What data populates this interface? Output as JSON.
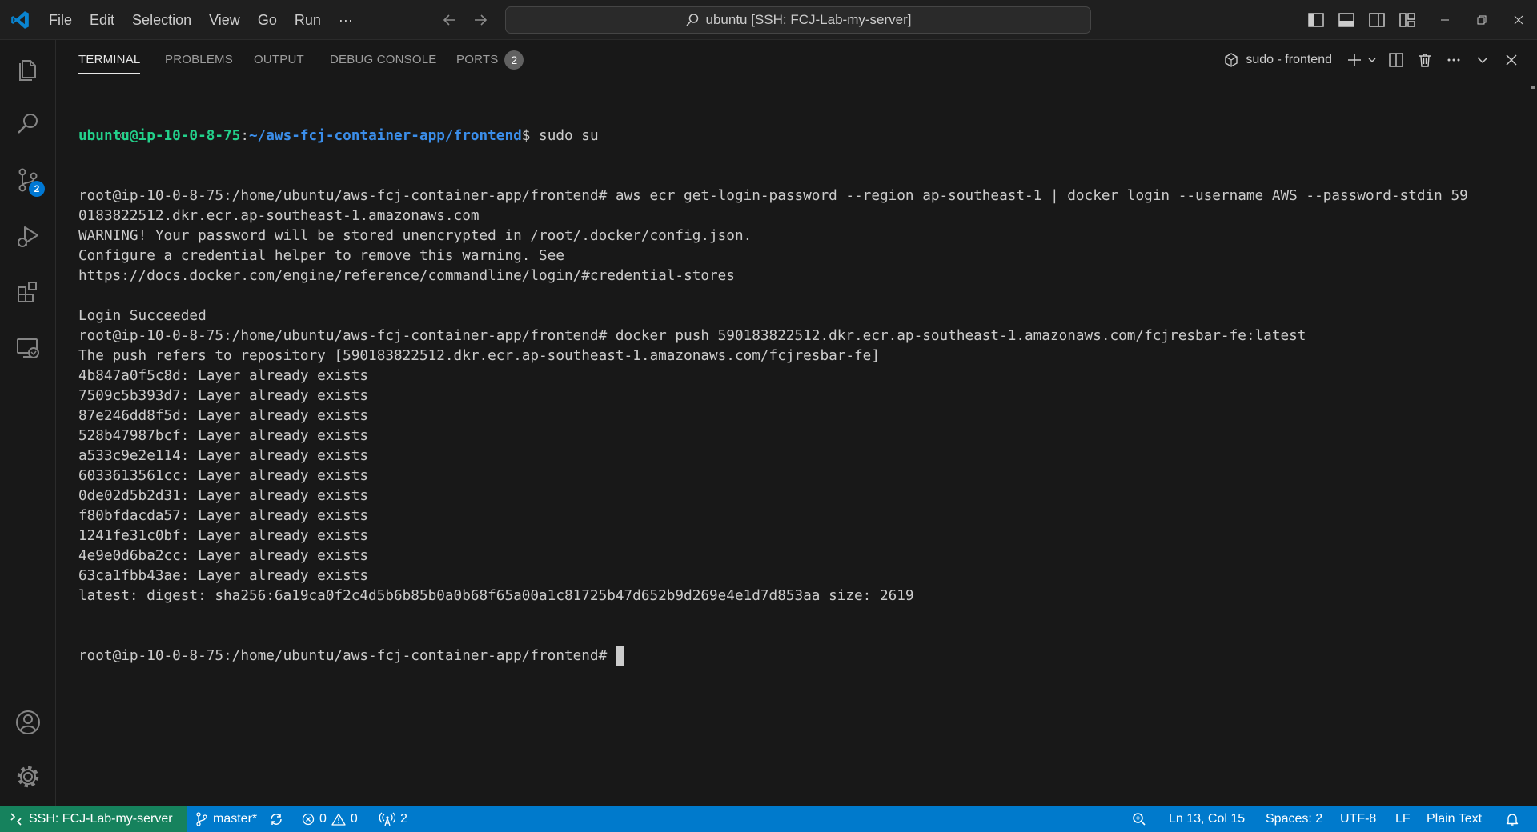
{
  "titlebar": {
    "menu": [
      "File",
      "Edit",
      "Selection",
      "View",
      "Go",
      "Run",
      "···"
    ],
    "command_center": "ubuntu [SSH: FCJ-Lab-my-server]"
  },
  "activitybar": {
    "items": [
      {
        "name": "explorer",
        "icon": "files-icon"
      },
      {
        "name": "search",
        "icon": "search-icon"
      },
      {
        "name": "source-control",
        "icon": "source-control-icon",
        "badge": "2"
      },
      {
        "name": "run-debug",
        "icon": "run-debug-icon"
      },
      {
        "name": "extensions",
        "icon": "extensions-icon"
      },
      {
        "name": "remote-explorer",
        "icon": "remote-explorer-icon"
      },
      {
        "name": "accounts",
        "icon": "account-icon"
      },
      {
        "name": "manage",
        "icon": "gear-icon"
      }
    ]
  },
  "panel": {
    "tabs": {
      "terminal": "TERMINAL",
      "problems": "PROBLEMS",
      "output": "OUTPUT",
      "debug_console": "DEBUG CONSOLE",
      "ports": "PORTS",
      "ports_count": "2"
    },
    "active_tab": "TERMINAL",
    "terminal_name": "sudo - frontend"
  },
  "terminal": {
    "first_prompt": {
      "user_host": "ubuntu@ip-10-0-8-75",
      "sep": ":",
      "path": "~/aws-fcj-container-app/frontend",
      "symbol": "$",
      "command": " sudo su"
    },
    "lines": [
      "root@ip-10-0-8-75:/home/ubuntu/aws-fcj-container-app/frontend# aws ecr get-login-password --region ap-southeast-1 | docker login --username AWS --password-stdin 59",
      "0183822512.dkr.ecr.ap-southeast-1.amazonaws.com",
      "WARNING! Your password will be stored unencrypted in /root/.docker/config.json.",
      "Configure a credential helper to remove this warning. See",
      "https://docs.docker.com/engine/reference/commandline/login/#credential-stores",
      "",
      "Login Succeeded",
      "root@ip-10-0-8-75:/home/ubuntu/aws-fcj-container-app/frontend# docker push 590183822512.dkr.ecr.ap-southeast-1.amazonaws.com/fcjresbar-fe:latest",
      "The push refers to repository [590183822512.dkr.ecr.ap-southeast-1.amazonaws.com/fcjresbar-fe]",
      "4b847a0f5c8d: Layer already exists",
      "7509c5b393d7: Layer already exists",
      "87e246dd8f5d: Layer already exists",
      "528b47987bcf: Layer already exists",
      "a533c9e2e114: Layer already exists",
      "6033613561cc: Layer already exists",
      "0de02d5b2d31: Layer already exists",
      "f80bfdacda57: Layer already exists",
      "1241fe31c0bf: Layer already exists",
      "4e9e0d6ba2cc: Layer already exists",
      "63ca1fbb43ae: Layer already exists",
      "latest: digest: sha256:6a19ca0f2c4d5b6b85b0a0b68f65a00a1c81725b47d652b9d269e4e1d7d853aa size: 2619"
    ],
    "current_prompt": "root@ip-10-0-8-75:/home/ubuntu/aws-fcj-container-app/frontend# "
  },
  "statusbar": {
    "remote": "SSH: FCJ-Lab-my-server",
    "branch": "master*",
    "errors": "0",
    "warnings": "0",
    "ports": "2",
    "position": "Ln 13, Col 15",
    "spaces": "Spaces: 2",
    "encoding": "UTF-8",
    "eol": "LF",
    "language": "Plain Text"
  },
  "colors": {
    "statusbar": "#007acc",
    "remote": "#16825d",
    "prompt_user": "#23d18b",
    "prompt_path": "#3b8eea",
    "vscode_blue": "#0078d4"
  }
}
